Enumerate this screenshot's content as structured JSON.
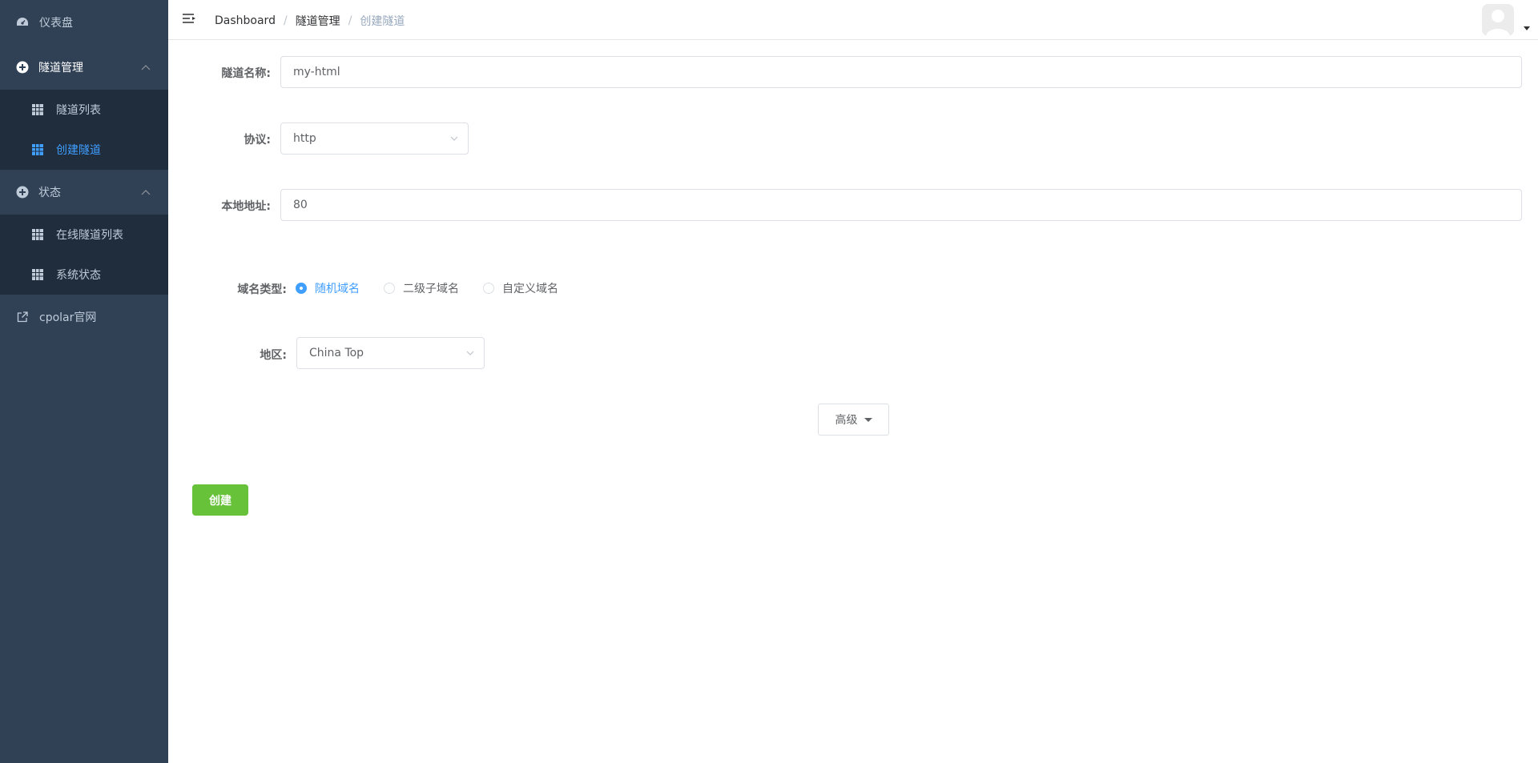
{
  "sidebar": {
    "dashboard": {
      "label": "仪表盘"
    },
    "tunnel_mgmt": {
      "label": "隧道管理"
    },
    "tunnel_list": {
      "label": "隧道列表"
    },
    "create_tunnel": {
      "label": "创建隧道"
    },
    "status": {
      "label": "状态"
    },
    "online_tunnels": {
      "label": "在线隧道列表"
    },
    "system_status": {
      "label": "系统状态"
    },
    "official_site": {
      "label": "cpolar官网"
    }
  },
  "breadcrumb": [
    "Dashboard",
    "隧道管理",
    "创建隧道"
  ],
  "breadcrumb_sep": "/",
  "form": {
    "name_label": "隧道名称:",
    "name_value": "my-html",
    "protocol_label": "协议:",
    "protocol_value": "http",
    "local_label": "本地地址:",
    "local_value": "80",
    "domain_type_label": "域名类型:",
    "domain_types": [
      "随机域名",
      "二级子域名",
      "自定义域名"
    ],
    "domain_type_selected": "随机域名",
    "region_label": "地区:",
    "region_value": "China Top",
    "advanced_label": "高级",
    "create_label": "创建"
  },
  "colors": {
    "sidebar_bg": "#304156",
    "submenu_bg": "#1f2d3d",
    "active": "#409eff",
    "create_button": "#67c23a"
  },
  "icons": {
    "dashboard": "dashboard-icon",
    "tunnel_mgmt": "plus-circle-icon",
    "table": "table-icon",
    "status": "plus-circle-icon",
    "external": "external-link-icon",
    "hamburger": "hamburger-icon"
  }
}
